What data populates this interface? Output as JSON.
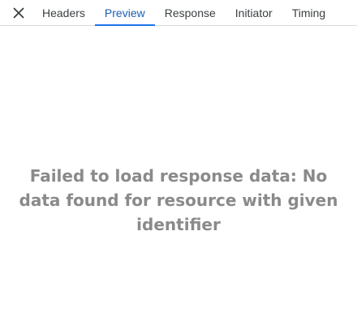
{
  "tabs": [
    {
      "label": "Headers",
      "active": false
    },
    {
      "label": "Preview",
      "active": true
    },
    {
      "label": "Response",
      "active": false
    },
    {
      "label": "Initiator",
      "active": false
    },
    {
      "label": "Timing",
      "active": false
    }
  ],
  "close_icon": "close-icon",
  "message": "Failed to load response data: No data found for resource with given identifier",
  "colors": {
    "active_tab_text": "#1a5fb4",
    "active_tab_underline": "#1a73e8",
    "message_text": "#8a8a8a"
  }
}
